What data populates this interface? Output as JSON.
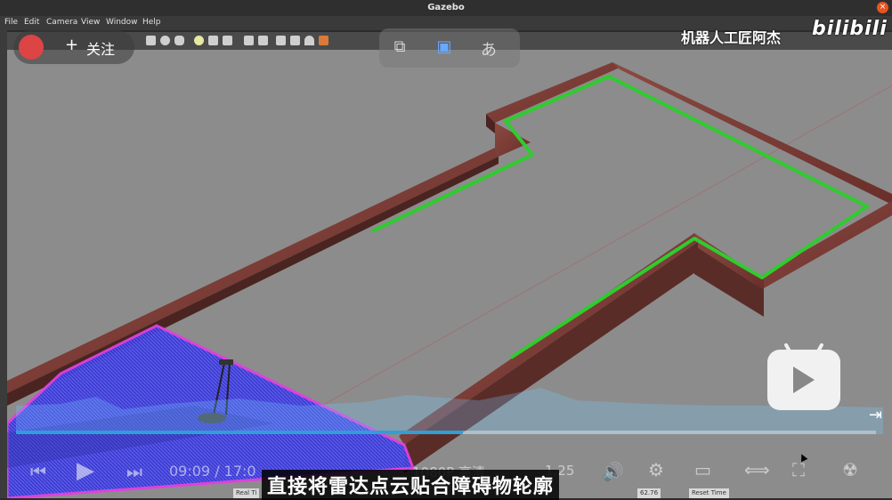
{
  "window": {
    "title": "Gazebo",
    "close_glyph": "×"
  },
  "menu": {
    "items": [
      "File",
      "Edit",
      "Camera",
      "View",
      "Window",
      "Help"
    ]
  },
  "overlay": {
    "follow_plus": "+",
    "follow_label": "关注"
  },
  "watermark": {
    "channel": "机器人工匠阿杰",
    "site_logo": "bilibili"
  },
  "player": {
    "time": "09:09 / 17:0",
    "quality": "1080P 高清",
    "speed": "1.25",
    "progress_fraction": 0.52,
    "subtitle": "直接将雷达点云贴合障碍物轮廓"
  },
  "status": {
    "real_time_label": "Real Ti",
    "fps_value": "62.76",
    "reset_button": "Reset Time"
  },
  "icons": {
    "top_pills": [
      "pip-icon",
      "play-square-icon",
      "translate-icon"
    ],
    "player": [
      "prev-icon",
      "play-icon",
      "next-icon",
      "volume-icon",
      "settings-icon",
      "pip-mode-icon",
      "widescreen-icon",
      "fullscreen-icon",
      "danmaku-icon"
    ]
  },
  "colors": {
    "laser_outline": "#e040e0",
    "laser_fill": "#3b3bd9",
    "path_green": "#2ecc2e",
    "wall": "#7a3b33",
    "ground": "#8c8c8c",
    "progress": "#2f9fd8"
  }
}
